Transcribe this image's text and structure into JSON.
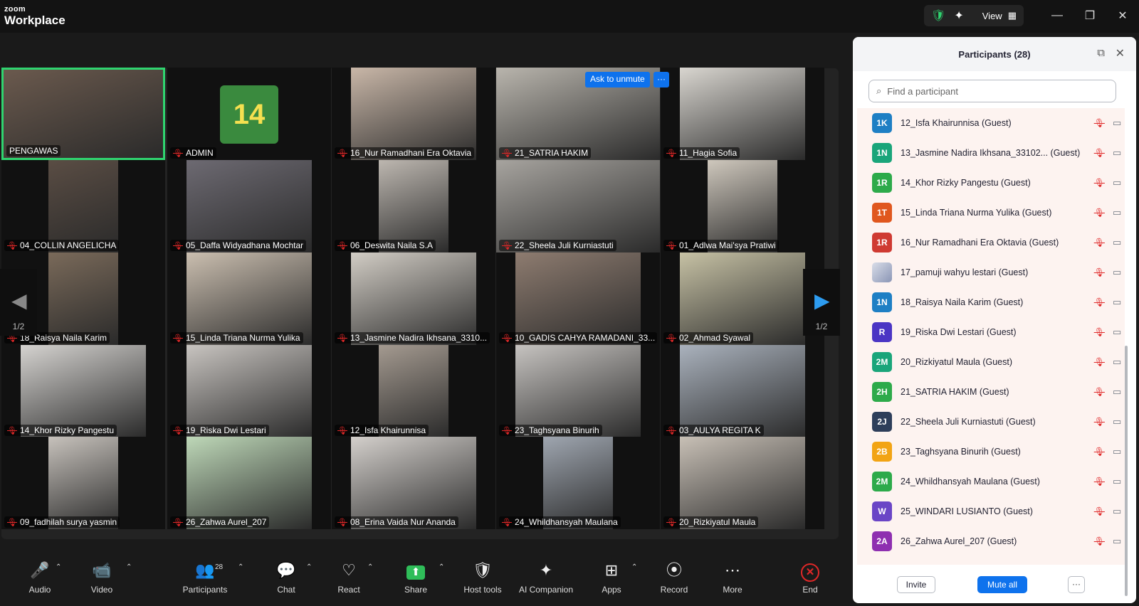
{
  "app": {
    "brand_small": "zoom",
    "brand_big": "Workplace",
    "view_label": "View"
  },
  "meeting": {
    "unmute_label": "Ask to unmute",
    "more_label": "···",
    "page_indicator": "1/2"
  },
  "tiles": [
    {
      "name": "PENGAWAS",
      "muted": false
    },
    {
      "name": "ADMIN",
      "muted": true
    },
    {
      "name": "16_Nur Ramadhani Era Oktavia",
      "muted": true
    },
    {
      "name": "21_SATRIA HAKIM",
      "muted": true
    },
    {
      "name": "11_Hagia Sofia",
      "muted": true
    },
    {
      "name": "04_COLLIN ANGELICHA",
      "muted": true
    },
    {
      "name": "05_Daffa Widyadhana Mochtar",
      "muted": true
    },
    {
      "name": "06_Deswita Naila S.A",
      "muted": true
    },
    {
      "name": "22_Sheela Juli Kurniastuti",
      "muted": true
    },
    {
      "name": "01_Adlwa Mai'sya Pratiwi",
      "muted": true
    },
    {
      "name": "18_Raisya Naila Karim",
      "muted": true
    },
    {
      "name": "15_Linda Triana Nurma Yulika",
      "muted": true
    },
    {
      "name": "13_Jasmine Nadira Ikhsana_3310...",
      "muted": true
    },
    {
      "name": "10_GADIS CAHYA RAMADANI_33...",
      "muted": true
    },
    {
      "name": "02_Ahmad Syawal",
      "muted": true
    },
    {
      "name": "14_Khor Rizky Pangestu",
      "muted": true
    },
    {
      "name": "19_Riska Dwi Lestari",
      "muted": true
    },
    {
      "name": "12_Isfa Khairunnisa",
      "muted": true
    },
    {
      "name": "23_Taghsyana Binurih",
      "muted": true
    },
    {
      "name": "03_AULYA REGITA K",
      "muted": true
    },
    {
      "name": "09_fadhilah surya yasmin",
      "muted": true
    },
    {
      "name": "26_Zahwa Aurel_207",
      "muted": true
    },
    {
      "name": "08_Erina Vaida Nur Ananda",
      "muted": true
    },
    {
      "name": "24_Whildhansyah Maulana",
      "muted": true
    },
    {
      "name": "20_Rizkiyatul Maula",
      "muted": true
    }
  ],
  "toolbar": {
    "audio": "Audio",
    "video": "Video",
    "participants": "Participants",
    "participants_count": "28",
    "chat": "Chat",
    "react": "React",
    "share": "Share",
    "host_tools": "Host tools",
    "ai_companion": "AI Companion",
    "apps": "Apps",
    "record": "Record",
    "more": "More",
    "end": "End"
  },
  "panel": {
    "title": "Participants (28)",
    "search_placeholder": "Find a participant",
    "invite": "Invite",
    "mute_all": "Mute all",
    "more": "···",
    "participants": [
      {
        "initials": "1K",
        "color": "#1e7fc4",
        "name": "12_Isfa Khairunnisa (Guest)"
      },
      {
        "initials": "1N",
        "color": "#1aa57a",
        "name": "13_Jasmine Nadira Ikhsana_33102... (Guest)"
      },
      {
        "initials": "1R",
        "color": "#2daa4a",
        "name": "14_Khor Rizky Pangestu (Guest)"
      },
      {
        "initials": "1T",
        "color": "#e0571e",
        "name": "15_Linda Triana Nurma Yulika (Guest)"
      },
      {
        "initials": "1R",
        "color": "#cf3a32",
        "name": "16_Nur Ramadhani Era Oktavia (Guest)"
      },
      {
        "initials": "",
        "color": "",
        "name": "17_pamuji wahyu lestari (Guest)"
      },
      {
        "initials": "1N",
        "color": "#1e7fc4",
        "name": "18_Raisya Naila Karim (Guest)"
      },
      {
        "initials": "R",
        "color": "#4b35c4",
        "name": "19_Riska Dwi Lestari (Guest)"
      },
      {
        "initials": "2M",
        "color": "#1aa57a",
        "name": "20_Rizkiyatul Maula (Guest)"
      },
      {
        "initials": "2H",
        "color": "#2daa4a",
        "name": "21_SATRIA HAKIM (Guest)"
      },
      {
        "initials": "2J",
        "color": "#2d3e5a",
        "name": "22_Sheela Juli Kurniastuti (Guest)"
      },
      {
        "initials": "2B",
        "color": "#f2a414",
        "name": "23_Taghsyana Binurih (Guest)"
      },
      {
        "initials": "2M",
        "color": "#2daa4a",
        "name": "24_Whildhansyah Maulana (Guest)"
      },
      {
        "initials": "W",
        "color": "#6a45c6",
        "name": "25_WINDARI LUSIANTO (Guest)"
      },
      {
        "initials": "2A",
        "color": "#8e2fb0",
        "name": "26_Zahwa Aurel_207 (Guest)"
      }
    ]
  }
}
